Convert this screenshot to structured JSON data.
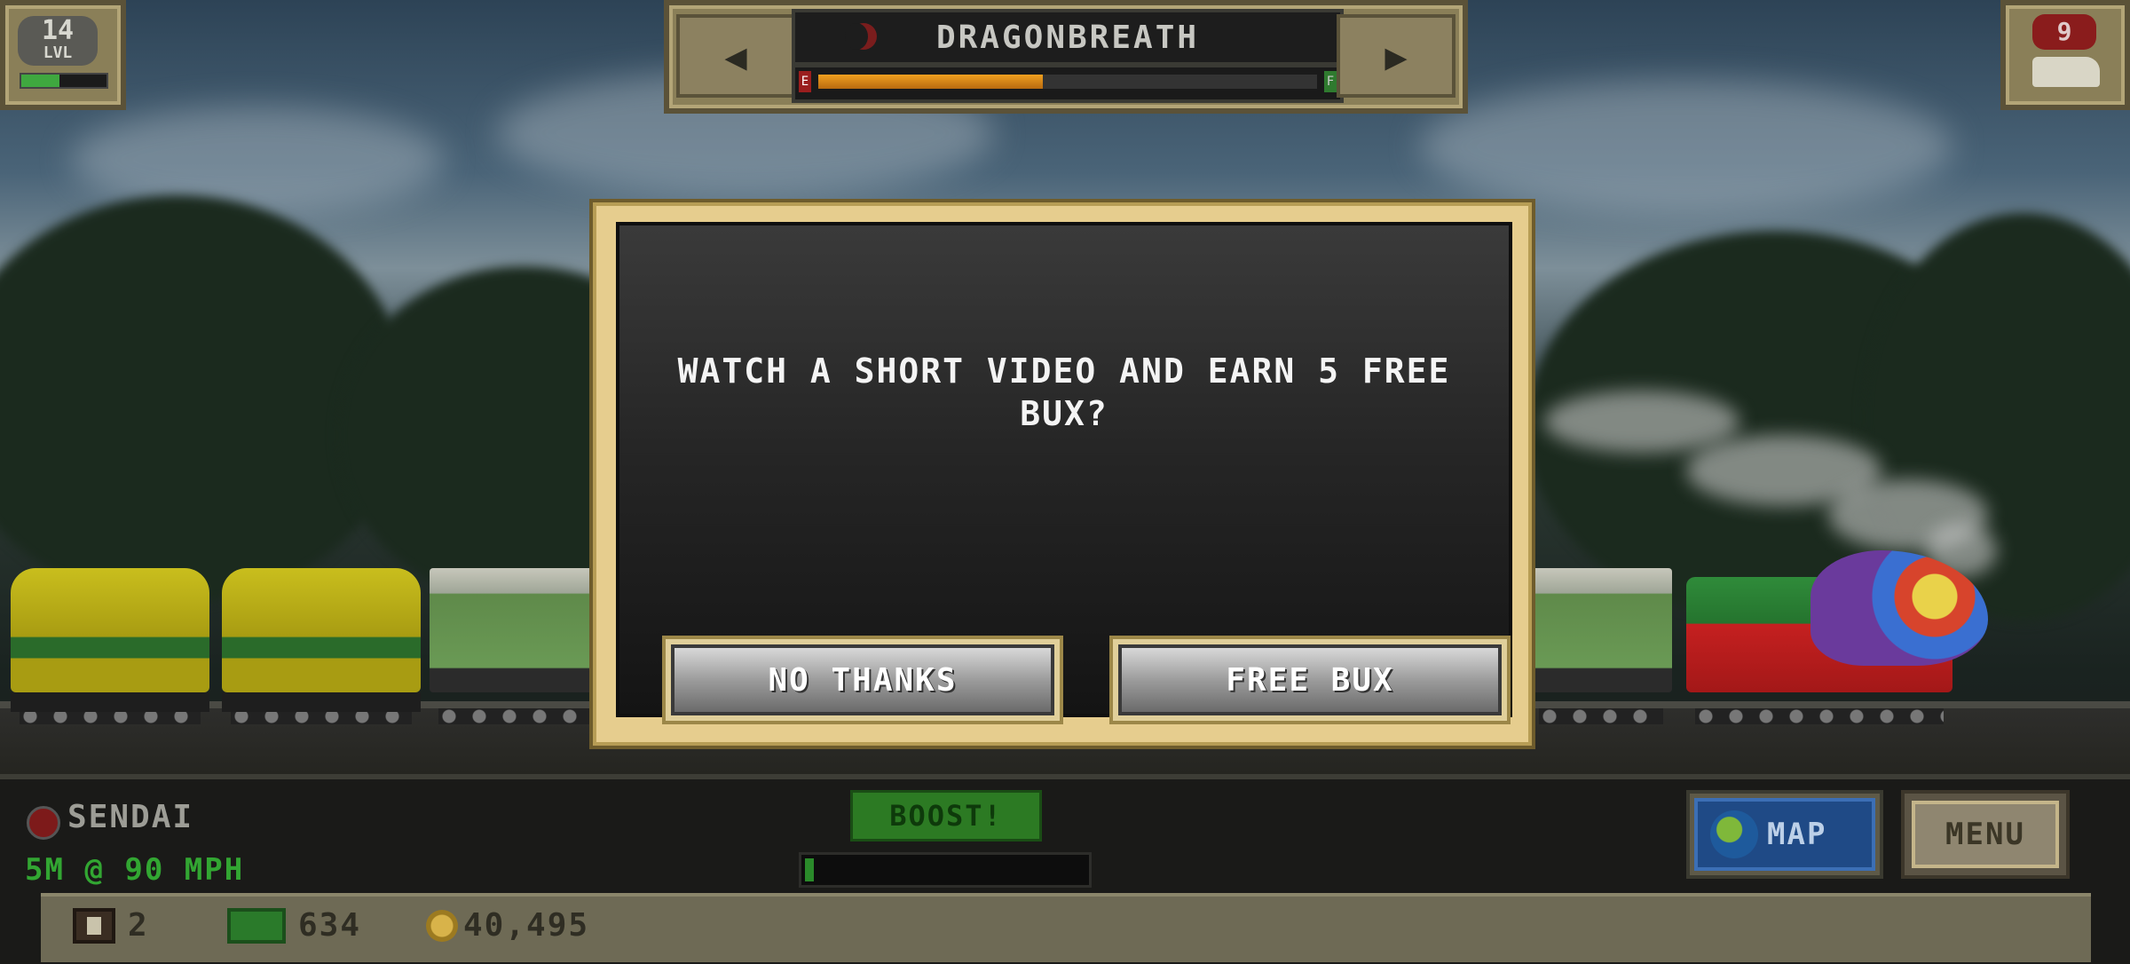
{
  "hud": {
    "level": {
      "number": "14",
      "label": "LVL",
      "xp_progress": 0.45
    },
    "train": {
      "name": "DRAGONBREATH",
      "prev_icon": "left-arrow-icon",
      "next_icon": "right-arrow-icon",
      "fuel_empty_label": "E",
      "fuel_full_label": "F",
      "fuel_level": 0.45
    },
    "passengers": {
      "count": "9"
    }
  },
  "dialog": {
    "message": "WATCH A SHORT VIDEO AND EARN 5 FREE BUX?",
    "decline_label": "NO THANKS",
    "accept_label": "FREE BUX"
  },
  "status": {
    "station": "SENDAI",
    "distance_speed": "5M @ 90 MPH",
    "boost_label": "BOOST!",
    "boost_progress": 0.03,
    "map_label": "MAP",
    "menu_label": "MENU"
  },
  "resources": {
    "crates": "2",
    "bux": "634",
    "coins": "40,495"
  },
  "colors": {
    "dialog_frame": "#e6cd8e",
    "speed_text": "#32a632",
    "map_button": "#1f4a86"
  }
}
